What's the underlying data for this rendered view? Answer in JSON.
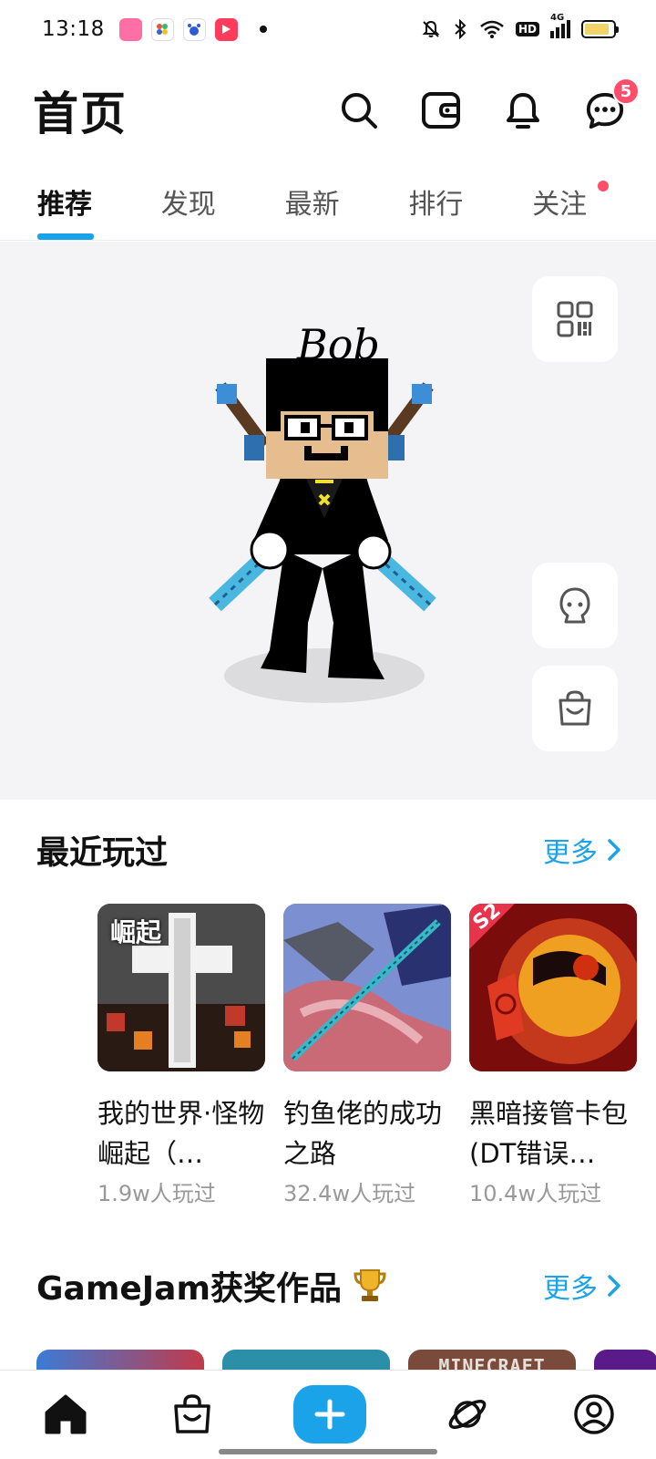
{
  "status_bar": {
    "time": "13:18",
    "network": "4G",
    "hd": "HD",
    "battery_level": 0.85,
    "icons": [
      "mute-icon",
      "bluetooth-icon",
      "wifi-icon",
      "signal-icon"
    ]
  },
  "header": {
    "title": "首页",
    "messages_badge": "5"
  },
  "tabs": [
    {
      "label": "推荐",
      "active": true
    },
    {
      "label": "发现"
    },
    {
      "label": "最新"
    },
    {
      "label": "排行"
    },
    {
      "label": "关注",
      "has_dot": true
    }
  ],
  "avatar": {
    "name": "Bob"
  },
  "recent": {
    "title": "最近玩过",
    "more": "更多",
    "games": [
      {
        "name": "我的世界·怪物崛起（…",
        "plays": "1.9w人玩过",
        "thumb_text": "崛起"
      },
      {
        "name": "钓鱼佬的成功之路",
        "plays": "32.4w人玩过"
      },
      {
        "name": "黑暗接管卡包(DT错误…",
        "plays": "10.4w人玩过",
        "thumb_text": "S2"
      }
    ]
  },
  "gamejam": {
    "title": "GameJam获奖作品",
    "more": "更多",
    "thumb_text": "MINECRAFT"
  },
  "colors": {
    "accent": "#1aa3e8",
    "badge": "#ff4d6a"
  }
}
